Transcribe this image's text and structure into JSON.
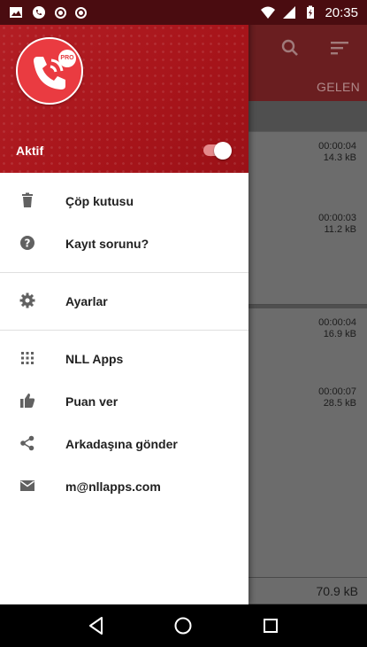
{
  "status_bar": {
    "time": "20:35",
    "icons": [
      "image-icon",
      "whatsapp-icon",
      "record-icon",
      "record-icon",
      "wifi-icon",
      "signal-icon",
      "battery-icon"
    ]
  },
  "app_background": {
    "tab_label": "GELEN",
    "items": [
      {
        "duration": "00:00:04",
        "size": "14.3 kB"
      },
      {
        "duration": "00:00:03",
        "size": "11.2 kB"
      },
      {
        "duration": "00:00:04",
        "size": "16.9 kB"
      },
      {
        "duration": "00:00:07",
        "size": "28.5 kB"
      }
    ],
    "footer_size": "70.9 kB"
  },
  "drawer": {
    "header": {
      "badge": "PRO",
      "active_label": "Aktif",
      "active_enabled": true,
      "accent_color": "#b41f25"
    },
    "menu_groups": [
      [
        {
          "icon": "trash-icon",
          "label": "Çöp kutusu"
        },
        {
          "icon": "help-icon",
          "label": "Kayıt sorunu?"
        }
      ],
      [
        {
          "icon": "gear-icon",
          "label": "Ayarlar"
        }
      ],
      [
        {
          "icon": "apps-grid-icon",
          "label": "NLL Apps"
        },
        {
          "icon": "thumbs-up-icon",
          "label": "Puan ver"
        },
        {
          "icon": "share-icon",
          "label": "Arkadaşına gönder"
        },
        {
          "icon": "mail-icon",
          "label": "m@nllapps.com"
        }
      ]
    ]
  }
}
